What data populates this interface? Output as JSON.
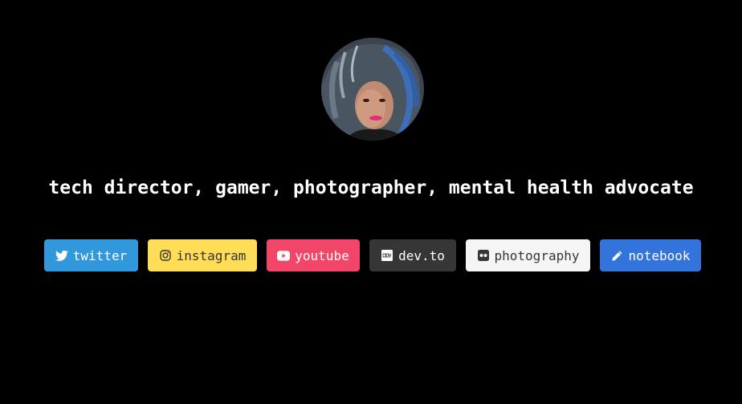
{
  "profile": {
    "tagline": "tech director, gamer, photographer, mental health advocate"
  },
  "links": [
    {
      "label": "twitter",
      "icon": "twitter-icon",
      "color": "#3298dc"
    },
    {
      "label": "instagram",
      "icon": "instagram-icon",
      "color": "#ffdd57"
    },
    {
      "label": "youtube",
      "icon": "youtube-icon",
      "color": "#f14668"
    },
    {
      "label": "dev.to",
      "icon": "devto-icon",
      "color": "#363636"
    },
    {
      "label": "photography",
      "icon": "flickr-icon",
      "color": "#f5f5f5"
    },
    {
      "label": "notebook",
      "icon": "pencil-icon",
      "color": "#3273dc"
    }
  ],
  "colors": {
    "background": "#000000",
    "text": "#ffffff"
  }
}
